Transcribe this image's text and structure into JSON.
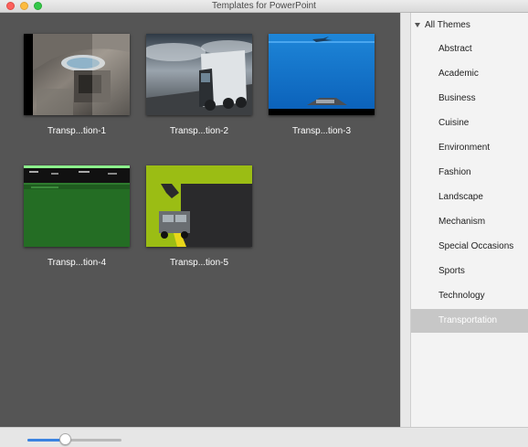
{
  "window": {
    "title": "Templates for PowerPoint"
  },
  "templates": [
    {
      "name": "Transp...tion-1"
    },
    {
      "name": "Transp...tion-2"
    },
    {
      "name": "Transp...tion-3"
    },
    {
      "name": "Transp...tion-4"
    },
    {
      "name": "Transp...tion-5"
    }
  ],
  "sidebar": {
    "root_label": "All Themes",
    "items": [
      {
        "label": "Abstract"
      },
      {
        "label": "Academic"
      },
      {
        "label": "Business"
      },
      {
        "label": "Cuisine"
      },
      {
        "label": "Environment"
      },
      {
        "label": "Fashion"
      },
      {
        "label": "Landscape"
      },
      {
        "label": "Mechanism"
      },
      {
        "label": "Special Occasions"
      },
      {
        "label": "Sports"
      },
      {
        "label": "Technology"
      },
      {
        "label": "Transportation",
        "selected": true
      }
    ]
  },
  "zoom_slider": {
    "value_fraction": 0.4
  },
  "colors": {
    "gallery_bg": "#555555",
    "selected_item_bg": "#c7c7c7",
    "accent": "#3b83e0"
  }
}
